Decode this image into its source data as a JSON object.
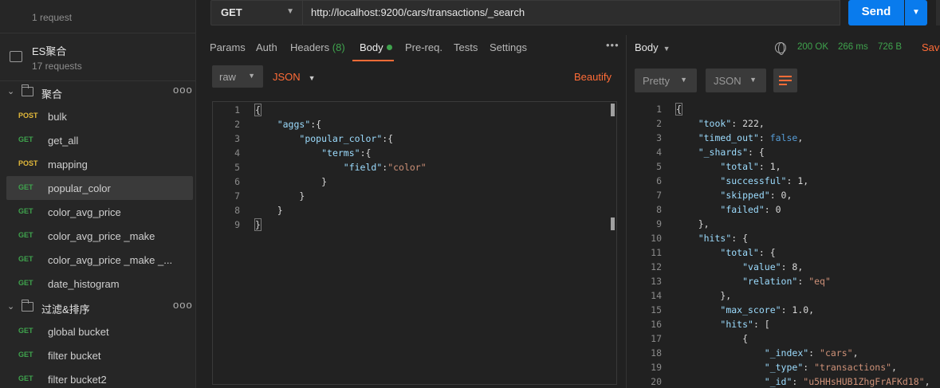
{
  "sidebar": {
    "collections": [
      {
        "name": "",
        "sub": "1 request"
      },
      {
        "name": "ES聚合",
        "sub": "17 requests"
      }
    ],
    "folders": [
      {
        "name": "聚合",
        "more": "ooo"
      },
      {
        "name": "过滤&排序",
        "more": "ooo"
      }
    ],
    "requests": [
      {
        "method": "POST",
        "name": "bulk"
      },
      {
        "method": "GET",
        "name": "get_all"
      },
      {
        "method": "POST",
        "name": "mapping"
      },
      {
        "method": "GET",
        "name": "popular_color"
      },
      {
        "method": "GET",
        "name": "color_avg_price"
      },
      {
        "method": "GET",
        "name": "color_avg_price _make"
      },
      {
        "method": "GET",
        "name": "color_avg_price _make _..."
      },
      {
        "method": "GET",
        "name": "date_histogram"
      },
      {
        "method": "GET",
        "name": "global bucket"
      },
      {
        "method": "GET",
        "name": "filter bucket"
      },
      {
        "method": "GET",
        "name": "filter bucket2"
      }
    ]
  },
  "request": {
    "method": "GET",
    "url": "http://localhost:9200/cars/transactions/_search",
    "send_label": "Send",
    "tabs": {
      "params": "Params",
      "auth": "Auth",
      "headers": "Headers",
      "headers_count": "(8)",
      "body": "Body",
      "prereq": "Pre-req.",
      "tests": "Tests",
      "settings": "Settings"
    },
    "more": "•••",
    "body_type": "raw",
    "format": "JSON",
    "beautify": "Beautify"
  },
  "response": {
    "title": "Body",
    "status": "200 OK",
    "time": "266 ms",
    "size": "726 B",
    "save": "Save",
    "view": "Pretty",
    "format": "JSON"
  },
  "req_code": [
    {
      "n": "1",
      "t": "{"
    },
    {
      "n": "2",
      "t": "    \"aggs\":{"
    },
    {
      "n": "3",
      "t": "        \"popular_color\":{"
    },
    {
      "n": "4",
      "t": "            \"terms\":{"
    },
    {
      "n": "5",
      "t": "                \"field\":\"color\""
    },
    {
      "n": "6",
      "t": "            }"
    },
    {
      "n": "7",
      "t": "        }"
    },
    {
      "n": "8",
      "t": "    }"
    },
    {
      "n": "9",
      "t": "}"
    }
  ],
  "res_code": [
    {
      "n": "1",
      "t": "{"
    },
    {
      "n": "2",
      "t": "    \"took\": 222,"
    },
    {
      "n": "3",
      "t": "    \"timed_out\": false,"
    },
    {
      "n": "4",
      "t": "    \"_shards\": {"
    },
    {
      "n": "5",
      "t": "        \"total\": 1,"
    },
    {
      "n": "6",
      "t": "        \"successful\": 1,"
    },
    {
      "n": "7",
      "t": "        \"skipped\": 0,"
    },
    {
      "n": "8",
      "t": "        \"failed\": 0"
    },
    {
      "n": "9",
      "t": "    },"
    },
    {
      "n": "10",
      "t": "    \"hits\": {"
    },
    {
      "n": "11",
      "t": "        \"total\": {"
    },
    {
      "n": "12",
      "t": "            \"value\": 8,"
    },
    {
      "n": "13",
      "t": "            \"relation\": \"eq\""
    },
    {
      "n": "14",
      "t": "        },"
    },
    {
      "n": "15",
      "t": "        \"max_score\": 1.0,"
    },
    {
      "n": "16",
      "t": "        \"hits\": ["
    },
    {
      "n": "17",
      "t": "            {"
    },
    {
      "n": "18",
      "t": "                \"_index\": \"cars\","
    },
    {
      "n": "19",
      "t": "                \"_type\": \"transactions\","
    },
    {
      "n": "20",
      "t": "                \"_id\": \"u5HHsHUB1ZhgFrAFKd18\","
    }
  ],
  "colors": {
    "accent": "#ff6c37",
    "send": "#097bed",
    "get": "#3fa34d",
    "post": "#e3b93a"
  }
}
